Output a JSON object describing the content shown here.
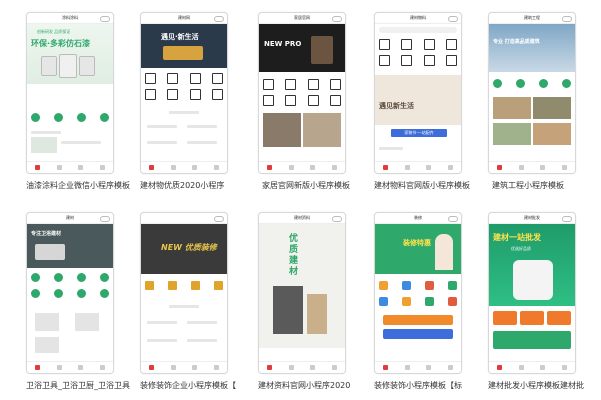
{
  "templates": [
    {
      "title": "涂料涂料",
      "label": "油漆涂料企业微信小程序模板",
      "hero_text": "环保·多彩仿石漆",
      "hero_sub": "创新研发 品质保证",
      "accent": "#2fa86b",
      "tabs": 4
    },
    {
      "title": "建材网",
      "label": "建材物优质2020小程序",
      "hero_text": "遇见·新生活",
      "accent": "#e23b3b",
      "tabs": 4
    },
    {
      "title": "家居官网",
      "label": "家居官网新版小程序模板",
      "hero_text": "NEW PRO",
      "accent": "#e23b3b",
      "tabs": 4
    },
    {
      "title": "建材物料",
      "label": "建材物料官网版小程序模板",
      "hero_text": "遇见新生活",
      "banner": "家装节·一站配齐",
      "accent": "#e23b3b",
      "tabs": 4
    },
    {
      "title": "建筑工程",
      "label": "建筑工程小程序模板",
      "hero_text": "专业 打造高品质建筑",
      "accent": "#2fa86b",
      "tabs": 4
    },
    {
      "title": "建材",
      "label": "卫浴卫具_卫浴卫厨_卫浴卫具",
      "hero_text": "专注卫浴建材",
      "accent": "#2fa86b",
      "tabs": 4
    },
    {
      "title": "",
      "label": "装修装饰企业小程序模板【",
      "hero_text": "NEW 优质装修",
      "accent": "#e23b3b",
      "tabs": 4
    },
    {
      "title": "建材资料",
      "label": "建材资料官网小程序2020",
      "hero_text": "优质建材",
      "accent": "#2fa86b",
      "tabs": 4
    },
    {
      "title": "装修",
      "label": "装修装饰小程序模板【标",
      "hero_text": "装修特惠",
      "accent": "#2fa86b",
      "tabs": 4
    },
    {
      "title": "建材批发",
      "label": "建材批发小程序模板建材批",
      "hero_text": "建材一站批发",
      "hero_sub": "优选好品质",
      "accent": "#2fa86b",
      "tabs": 4
    }
  ]
}
